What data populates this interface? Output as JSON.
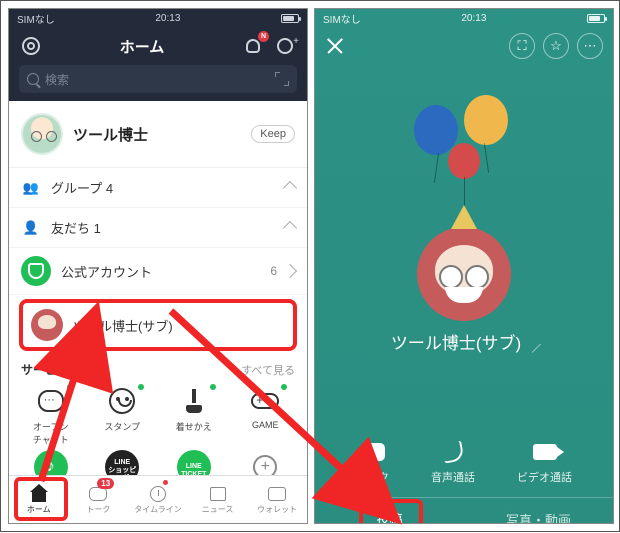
{
  "status": {
    "carrier": "SIMなし",
    "time": "20:13"
  },
  "left": {
    "header": {
      "title": "ホーム",
      "badge": "N"
    },
    "search": {
      "placeholder": "検索"
    },
    "profile": {
      "name": "ツール博士",
      "keep": "Keep"
    },
    "sections": {
      "group": {
        "label": "グループ",
        "count": "4"
      },
      "friends": {
        "label": "友だち",
        "count": "1"
      }
    },
    "official": {
      "label": "公式アカウント",
      "count": "6"
    },
    "friend_sub": {
      "name": "ツール博士(サブ)"
    },
    "services": {
      "header": "サービス",
      "more": "すべて見る",
      "items": [
        "オープン\nチャット",
        "スタンプ",
        "着せかえ",
        "GAME",
        "LINE MUSIC",
        "ショッピング",
        "LINEチケット",
        "追加"
      ],
      "blk1": "LINE\nショッピング",
      "blk2": "LINE\nTICKET"
    },
    "tabs": {
      "items": [
        "ホーム",
        "トーク",
        "タイムライン",
        "ニュース",
        "ウォレット"
      ],
      "talk_badge": "13"
    }
  },
  "right": {
    "name": "ツール博士(サブ)",
    "actions": {
      "talk": "トーク",
      "voice": "音声通話",
      "video": "ビデオ通話"
    },
    "tabs": {
      "post": "投稿",
      "media": "写真・動画"
    }
  }
}
